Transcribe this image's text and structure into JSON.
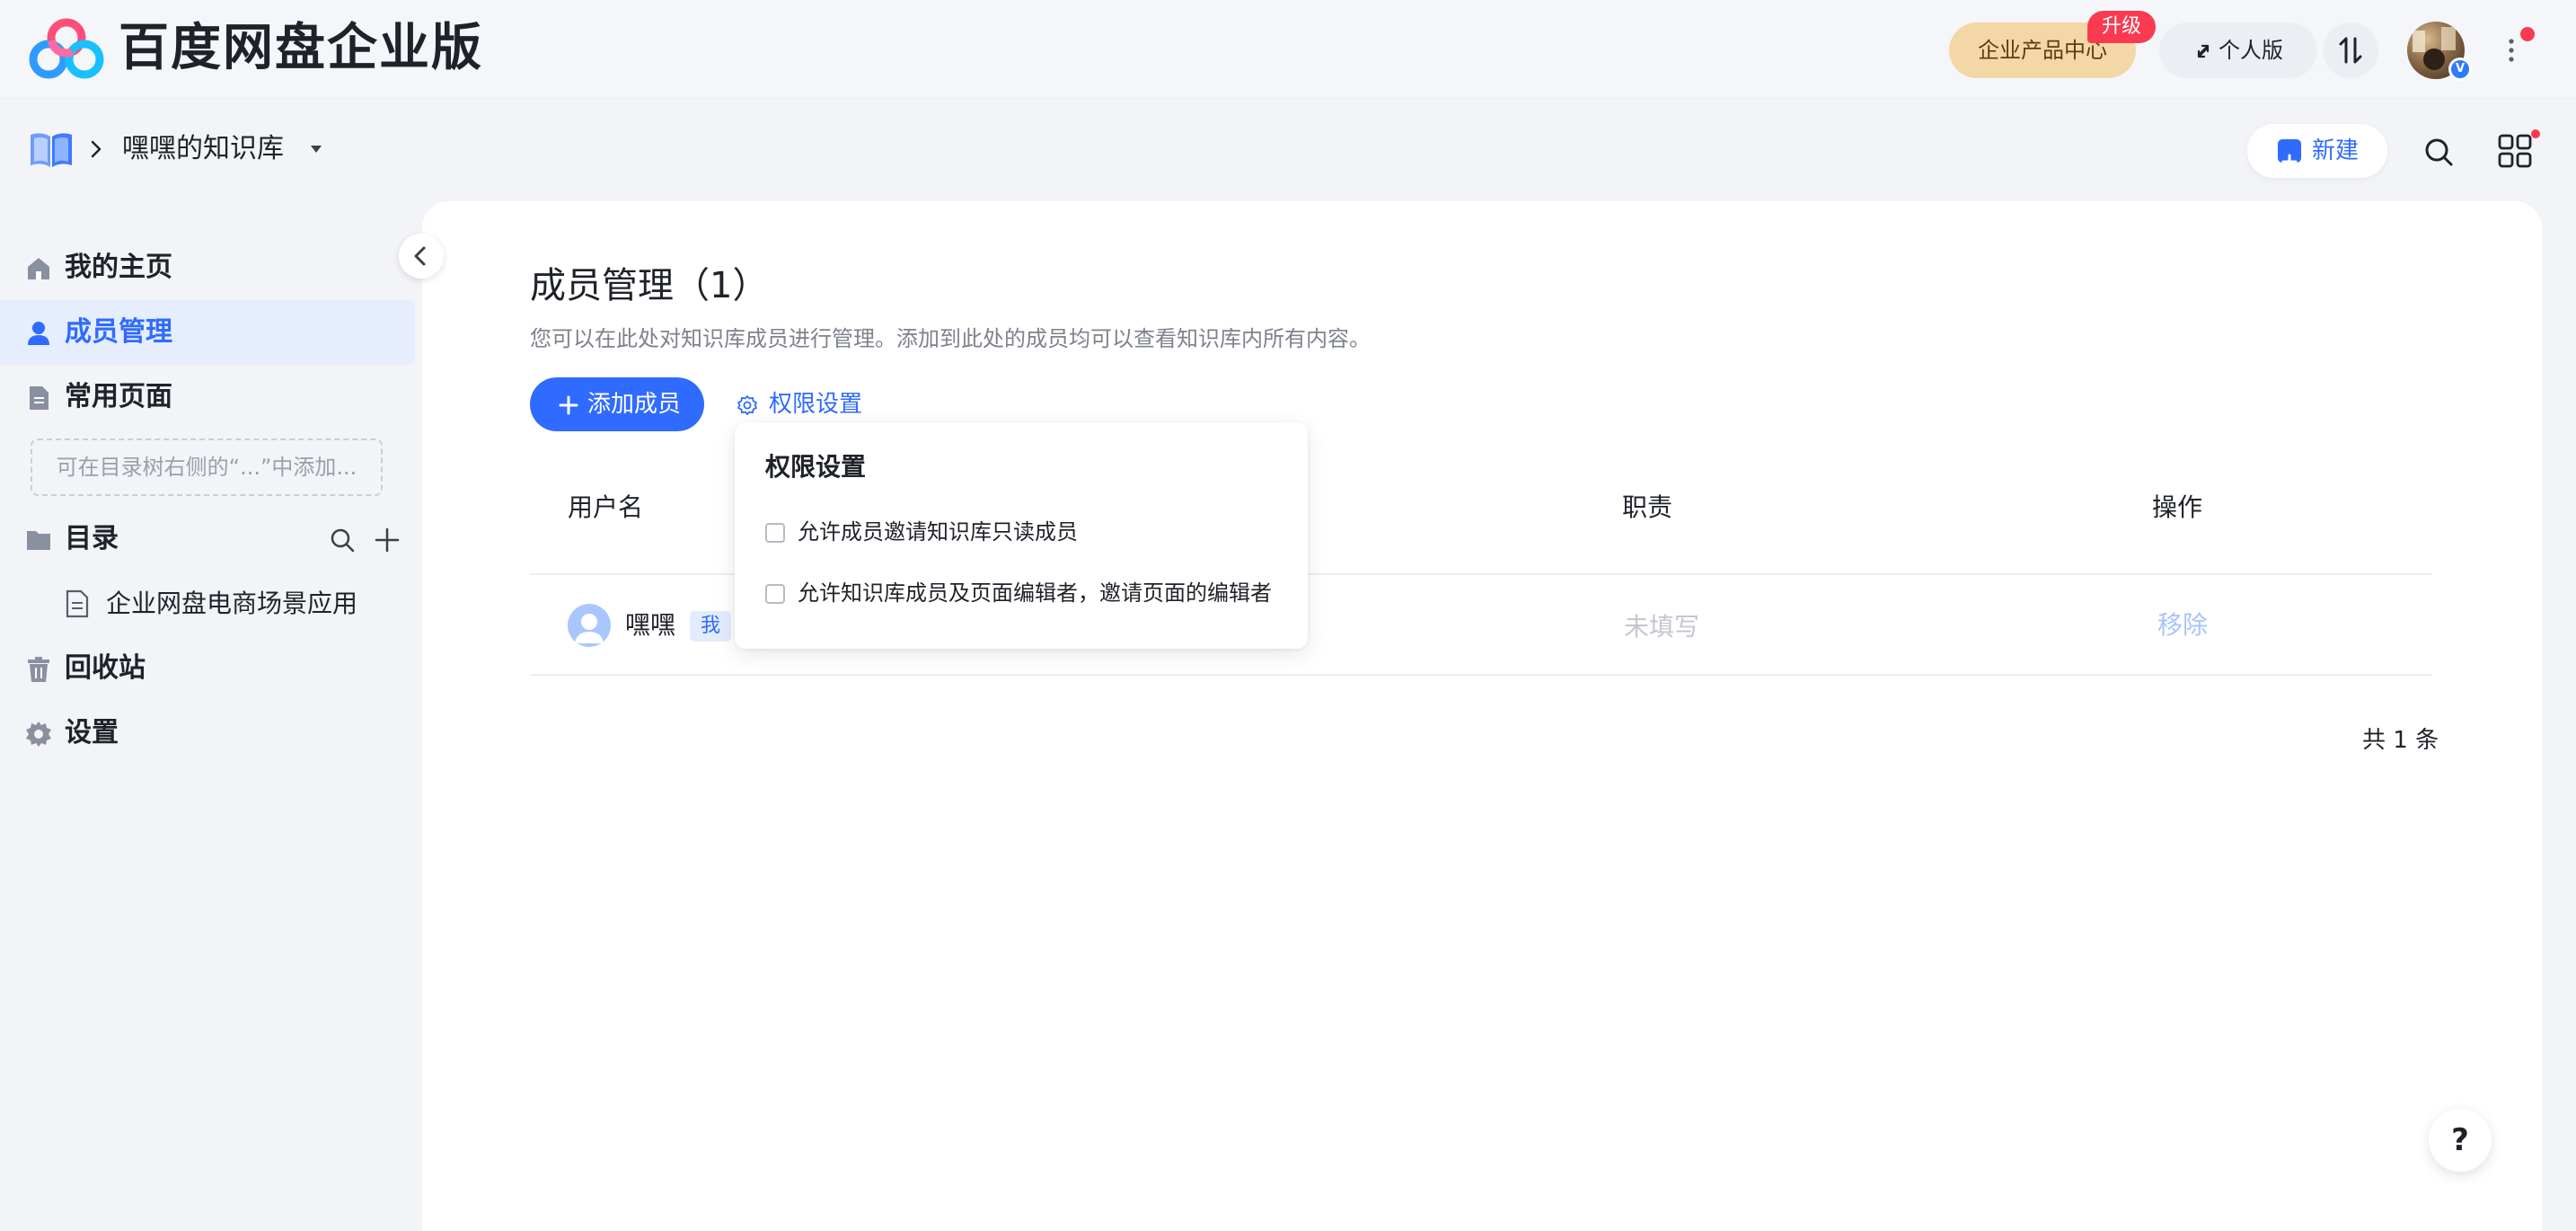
{
  "app": {
    "title": "百度网盘企业版",
    "enterprise_center": "企业产品中心",
    "upgrade_badge": "升级",
    "personal_version": "个人版",
    "verified_mark": "V"
  },
  "toolbar": {
    "knowledge_base_name": "嘿嘿的知识库",
    "new_label": "新建"
  },
  "sidebar": {
    "items": [
      {
        "label": "我的主页",
        "icon": "home-icon"
      },
      {
        "label": "成员管理",
        "icon": "member-icon",
        "active": true
      },
      {
        "label": "常用页面",
        "icon": "page-icon"
      },
      {
        "label": "目录",
        "icon": "folder-icon"
      },
      {
        "label": "回收站",
        "icon": "trash-icon"
      },
      {
        "label": "设置",
        "icon": "gear-icon"
      }
    ],
    "common_pages_hint": "可在目录树右侧的“...”中添加...",
    "directory_pages": [
      "企业网盘电商场景应用"
    ]
  },
  "main": {
    "title": "成员管理（1）",
    "description": "您可以在此处对知识库成员进行管理。添加到此处的成员均可以查看知识库内所有内容。",
    "add_member_label": "添加成员",
    "permission_link_label": "权限设置",
    "table": {
      "columns": [
        "用户名",
        "职责",
        "操作"
      ],
      "rows": [
        {
          "name": "嘿嘿",
          "tag": "我",
          "role": "未填写",
          "action": "移除"
        }
      ]
    },
    "total": "共 1 条"
  },
  "popover": {
    "title": "权限设置",
    "options": [
      {
        "label": "允许成员邀请知识库只读成员",
        "checked": false
      },
      {
        "label": "允许知识库成员及页面编辑者，邀请页面的编辑者",
        "checked": false
      }
    ]
  },
  "help_label": "?",
  "colors": {
    "accent": "#2f6bff",
    "upgrade_badge": "#fa3a50",
    "enterprise_pill": "#f4d7a6",
    "active_item_bg": "#e6edfd"
  }
}
